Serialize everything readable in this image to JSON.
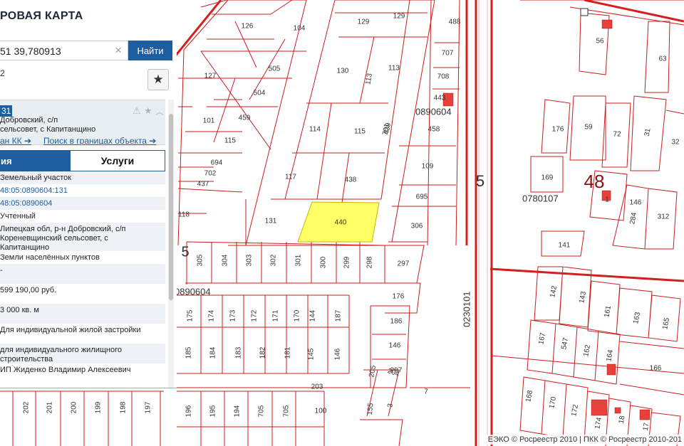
{
  "app": {
    "title": "РОВАЯ КАРТА"
  },
  "search": {
    "value": "51 39,780913",
    "find_label": "Найти",
    "clear_icon": "×"
  },
  "results": {
    "count": "2"
  },
  "card": {
    "number": "31",
    "address_line1": "Добровский, с/п",
    "address_line2": "сельсовет, с Капитанщино",
    "link_plan": "ан КК ➔",
    "link_search": "Поиск в границах объекта ➔",
    "tab_info": "ия",
    "tab_services": "Услуги",
    "rows": [
      {
        "text": "Земельный участок",
        "shade": true,
        "h": 18
      },
      {
        "text": "48:05:0890604:131",
        "link": true,
        "shade": false,
        "h": 18
      },
      {
        "text": "48:05:0890604",
        "link": true,
        "shade": true,
        "h": 18
      },
      {
        "text": "Учтенный",
        "shade": false,
        "h": 18
      },
      {
        "text": "Липецкая обл, р-н Добровский, с/п\nКореневщинский сельсовет, с\nКапитанщино",
        "shade": true,
        "h": 40
      },
      {
        "text": "Земли населённых пунктов",
        "shade": false,
        "h": 18
      },
      {
        "text": "-",
        "shade": true,
        "h": 28
      },
      {
        "text": "599 190,00 руб.",
        "shade": false,
        "h": 28
      },
      {
        "text": "3 000 кв. м",
        "shade": true,
        "h": 28
      },
      {
        "text": "Для индивидуальной жилой застройки",
        "shade": false,
        "h": 28
      },
      {
        "text": "для индивидуального жилищного\nстроительства",
        "shade": true,
        "h": 28
      },
      {
        "text": "ИП Жиденко Владимир Алексеевич",
        "shade": false,
        "h": 18
      }
    ]
  },
  "map": {
    "accent_line": "#d41f1f",
    "parcel_line": "#c81e1e",
    "selected_fill": "#ffff66",
    "labels": [
      "126",
      "104",
      "129",
      "129",
      "488",
      "505",
      "130",
      "113",
      "707",
      "127",
      "504",
      "113",
      "708",
      "443",
      "459",
      "101",
      "114",
      "115",
      "439",
      "458",
      "115",
      "701",
      "694",
      "117",
      "438",
      "109",
      "702",
      "437",
      "695",
      "118",
      "131",
      "440",
      "306",
      "305",
      "304",
      "303",
      "302",
      "301",
      "300",
      "299",
      "298",
      "297",
      "176",
      "175",
      "174",
      "173",
      "172",
      "171",
      "170",
      "144",
      "187",
      "186",
      "185",
      "184",
      "183",
      "182",
      "181",
      "145",
      "146",
      "146",
      "297",
      "205",
      "204",
      "203",
      "202",
      "201",
      "200",
      "199",
      "198",
      "197",
      "196",
      "195",
      "194",
      "705",
      "705",
      "100",
      "155",
      "3",
      "7",
      "56",
      "63",
      "176",
      "59",
      "72",
      "31",
      "32",
      "169",
      "1",
      "146",
      "284",
      "312",
      "141",
      "142",
      "143",
      "161",
      "163",
      "165",
      "167",
      "547",
      "162",
      "164",
      "166",
      "168",
      "170",
      "172",
      "174",
      "18",
      "17"
    ],
    "quarter_labels": [
      "0890604",
      "0890604",
      "0780107",
      "0230101"
    ],
    "big_labels": [
      "5",
      "5",
      "48"
    ],
    "attribution": "ЕЭКО © Росреестр 2010 | ПКК © Росреестр 2010-201"
  }
}
